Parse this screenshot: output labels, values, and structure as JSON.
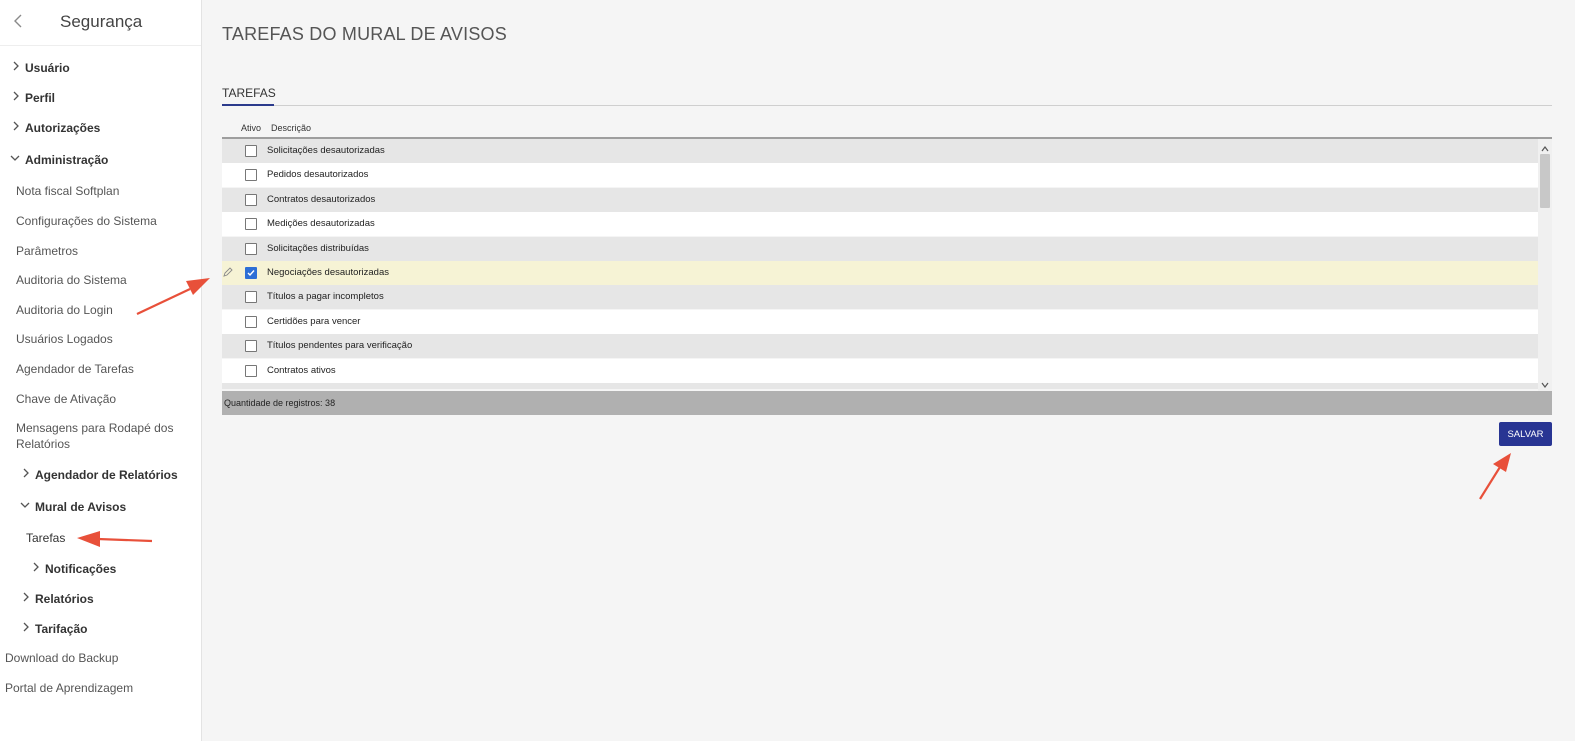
{
  "sidebar": {
    "title": "Segurança",
    "items": [
      {
        "label": "Usuário"
      },
      {
        "label": "Perfil"
      },
      {
        "label": "Autorizações"
      },
      {
        "label": "Administração"
      },
      {
        "label": "Nota fiscal Softplan"
      },
      {
        "label": "Configurações do Sistema"
      },
      {
        "label": "Parâmetros"
      },
      {
        "label": "Auditoria do Sistema"
      },
      {
        "label": "Auditoria do Login"
      },
      {
        "label": "Usuários Logados"
      },
      {
        "label": "Agendador de Tarefas"
      },
      {
        "label": "Chave de Ativação"
      },
      {
        "label": "Mensagens para Rodapé dos Relatórios"
      },
      {
        "label": "Agendador de Relatórios"
      },
      {
        "label": "Mural de Avisos"
      },
      {
        "label": "Tarefas"
      },
      {
        "label": "Notificações"
      },
      {
        "label": "Relatórios"
      },
      {
        "label": "Tarifação"
      },
      {
        "label": "Download do Backup"
      },
      {
        "label": "Portal de Aprendizagem"
      }
    ]
  },
  "main": {
    "title": "TAREFAS DO MURAL DE AVISOS",
    "tab": "TAREFAS",
    "columns": {
      "active": "Ativo",
      "description": "Descrição"
    },
    "rows": [
      {
        "description": "Solicitações desautorizadas",
        "active": false
      },
      {
        "description": "Pedidos desautorizados",
        "active": false
      },
      {
        "description": "Contratos desautorizados",
        "active": false
      },
      {
        "description": "Medições desautorizadas",
        "active": false
      },
      {
        "description": "Solicitações distribuídas",
        "active": false
      },
      {
        "description": "Negociações desautorizadas",
        "active": true
      },
      {
        "description": "Títulos a pagar incompletos",
        "active": false
      },
      {
        "description": "Certidões para vencer",
        "active": false
      },
      {
        "description": "Títulos pendentes para verificação",
        "active": false
      },
      {
        "description": "Contratos ativos",
        "active": false
      }
    ],
    "footer": "Quantidade de registros: 38",
    "save_label": "SALVAR"
  },
  "colors": {
    "accent": "#283593",
    "checkbox": "#2d6fd6",
    "selected_row": "#f6f3d5",
    "annotation_arrow": "#e8503a"
  }
}
